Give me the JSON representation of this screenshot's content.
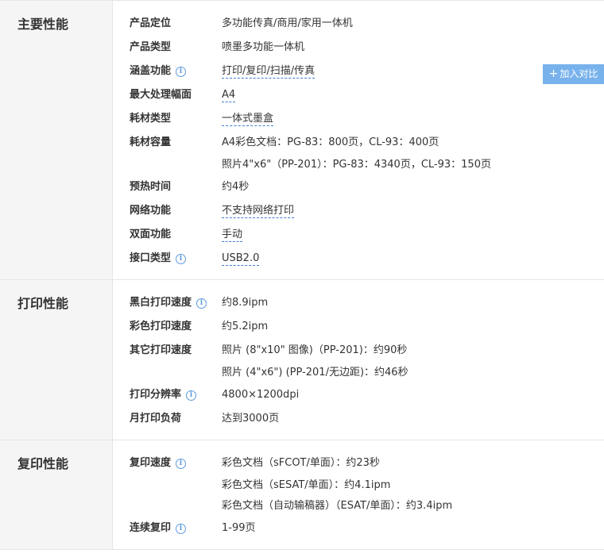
{
  "sections": [
    {
      "title": "主要性能",
      "rows": [
        {
          "label": "产品定位",
          "values": [
            "多功能传真/商用/家用一体机"
          ]
        },
        {
          "label": "产品类型",
          "values": [
            "喷墨多功能一体机"
          ]
        },
        {
          "label": "涵盖功能",
          "values": [
            "打印/复印/扫描/传真"
          ]
        },
        {
          "label": "最大处理幅面",
          "values": [
            "A4"
          ]
        },
        {
          "label": "耗材类型",
          "values": [
            "一体式墨盒"
          ]
        },
        {
          "label": "耗材容量",
          "values": [
            "A4彩色文档：PG-83：800页，CL-93：400页",
            "照片4\"x6\"（PP-201）：PG-83：4340页，CL-93：150页"
          ]
        },
        {
          "label": "预热时间",
          "values": [
            "约4秒"
          ]
        },
        {
          "label": "网络功能",
          "values": [
            "不支持网络打印"
          ]
        },
        {
          "label": "双面功能",
          "values": [
            "手动"
          ]
        },
        {
          "label": "接口类型",
          "values": [
            "USB2.0"
          ]
        }
      ]
    },
    {
      "title": "打印性能",
      "rows": [
        {
          "label": "黑白打印速度",
          "values": [
            "约8.9ipm"
          ]
        },
        {
          "label": "彩色打印速度",
          "values": [
            "约5.2ipm"
          ]
        },
        {
          "label": "其它打印速度",
          "values": [
            "照片 (8\"x10\" 图像)（PP-201)：约90秒",
            "照片 (4\"x6\") (PP-201/无边距)：约46秒"
          ]
        },
        {
          "label": "打印分辨率",
          "values": [
            "4800×1200dpi"
          ]
        },
        {
          "label": "月打印负荷",
          "values": [
            "达到3000页"
          ]
        }
      ]
    },
    {
      "title": "复印性能",
      "rows": [
        {
          "label": "复印速度",
          "values": [
            "彩色文档（sFCOT/单面）：约23秒",
            "彩色文档（sESAT/单面）：约4.1ipm",
            "彩色文档（自动输稿器）（ESAT/单面）：约3.4ipm"
          ]
        },
        {
          "label": "连续复印",
          "values": [
            "1-99页"
          ]
        }
      ]
    }
  ],
  "compare_button": {
    "icon": "+",
    "label": "加入对比"
  },
  "info_icon_glyph": "i"
}
